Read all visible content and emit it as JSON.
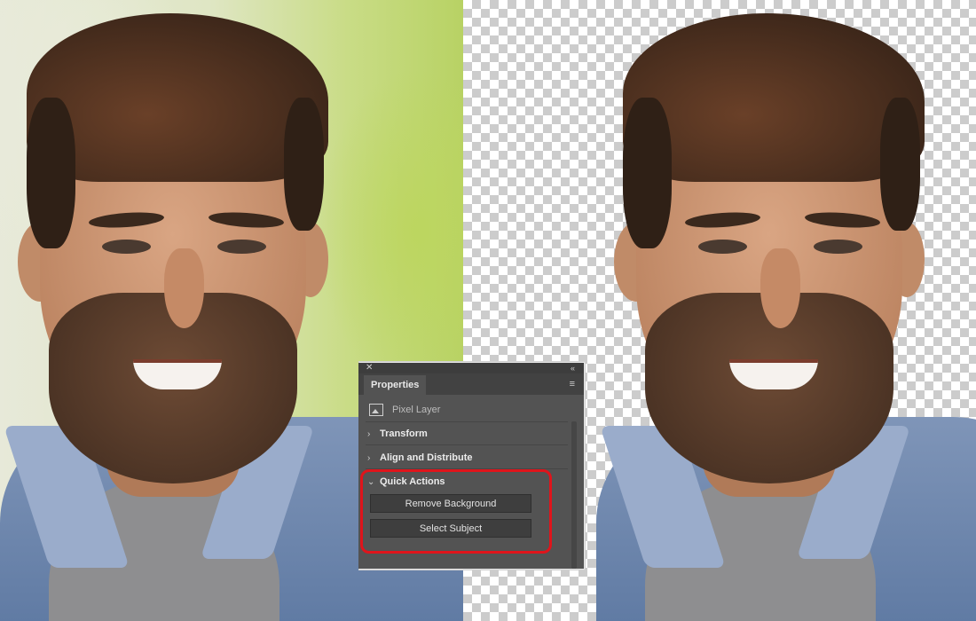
{
  "panel": {
    "tab_label": "Properties",
    "layer_type": "Pixel Layer",
    "sections": [
      {
        "label": "Transform",
        "expanded": false
      },
      {
        "label": "Align and Distribute",
        "expanded": false
      },
      {
        "label": "Quick Actions",
        "expanded": true
      }
    ],
    "quick_actions": {
      "remove_background_label": "Remove Background",
      "select_subject_label": "Select Subject"
    },
    "highlight_color": "#e0141b"
  },
  "icons": {
    "close": "close-icon",
    "collapse": "double-chevron-icon",
    "menu": "hamburger-menu-icon",
    "layer": "image-thumbnail-icon"
  }
}
